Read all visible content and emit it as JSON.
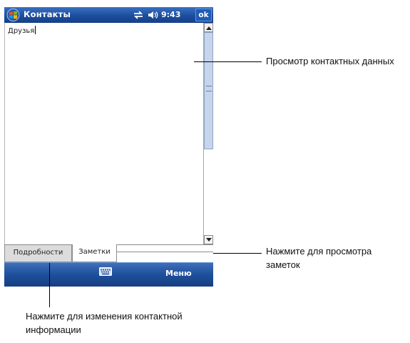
{
  "device": {
    "titlebar": {
      "app_title": "Контакты",
      "clock": "9:43",
      "ok_label": "ok",
      "icons": [
        "windows-start-icon",
        "sync-icon",
        "volume-icon"
      ]
    },
    "notes": {
      "text": "Друзья"
    },
    "tabs": [
      {
        "label": "Подробности",
        "selected": false
      },
      {
        "label": "Заметки",
        "selected": true
      }
    ],
    "menubar": {
      "keyboard_icon": "keyboard-icon",
      "menu_label": "Меню"
    },
    "colors": {
      "title_bar": "#1c4e9e",
      "menu_bar": "#1d4f9c",
      "scroll_thumb": "#c7d5ea"
    }
  },
  "callouts": {
    "view_contact": "Просмотр контактных данных",
    "view_notes_line1": "Нажмите для просмотра",
    "view_notes_line2": "заметок",
    "edit_contact_line1": "Нажмите для изменения контактной",
    "edit_contact_line2": "информации"
  }
}
